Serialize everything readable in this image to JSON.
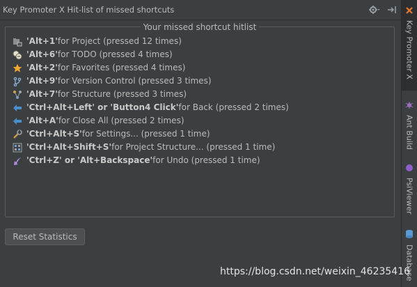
{
  "window": {
    "title": "Key Promoter X Hit-list of missed shortcuts"
  },
  "hitlist": {
    "title": "Your missed shortcut hitlist",
    "items": [
      {
        "keys": "'Alt+1'",
        "rest": " for Project (pressed 12 times)",
        "icon": "project-icon"
      },
      {
        "keys": "'Alt+6'",
        "rest": " for TODO (pressed 4 times)",
        "icon": "todo-icon"
      },
      {
        "keys": "'Alt+2'",
        "rest": " for Favorites (pressed 4 times)",
        "icon": "star-icon"
      },
      {
        "keys": "'Alt+9'",
        "rest": " for Version Control (pressed 3 times)",
        "icon": "version-control-icon"
      },
      {
        "keys": "'Alt+7'",
        "rest": " for Structure (pressed 3 times)",
        "icon": "structure-icon"
      },
      {
        "keys": "'Ctrl+Alt+Left' or 'Button4 Click'",
        "rest": " for Back (pressed 2 times)",
        "icon": "arrow-left-icon"
      },
      {
        "keys": "'Alt+A'",
        "rest": " for Close All (pressed 2 times)",
        "icon": "arrow-left-icon"
      },
      {
        "keys": "'Ctrl+Alt+S'",
        "rest": " for Settings... (pressed 1 time)",
        "icon": "wrench-icon"
      },
      {
        "keys": "'Ctrl+Alt+Shift+S'",
        "rest": " for Project Structure... (pressed 1 time)",
        "icon": "project-structure-icon"
      },
      {
        "keys": "'Ctrl+Z' or 'Alt+Backspace'",
        "rest": " for Undo (pressed 1 time)",
        "icon": "undo-icon"
      }
    ]
  },
  "buttons": {
    "reset_label": "Reset Statistics"
  },
  "right_tabs": [
    {
      "label": "Key Promoter X",
      "icon": "key-promoter-icon",
      "active": true
    },
    {
      "label": "Ant Build",
      "icon": "ant-icon",
      "active": false
    },
    {
      "label": "PsiViewer",
      "icon": "psi-icon",
      "active": false
    },
    {
      "label": "Database",
      "icon": "database-icon",
      "active": false
    }
  ],
  "watermark": {
    "text": "https://blog.csdn.net/weixin_46235416"
  },
  "colors": {
    "background": "#3c3f41",
    "text": "#bbbbbb",
    "accent_blue": "#4a8ecb",
    "star": "#f0a732"
  }
}
